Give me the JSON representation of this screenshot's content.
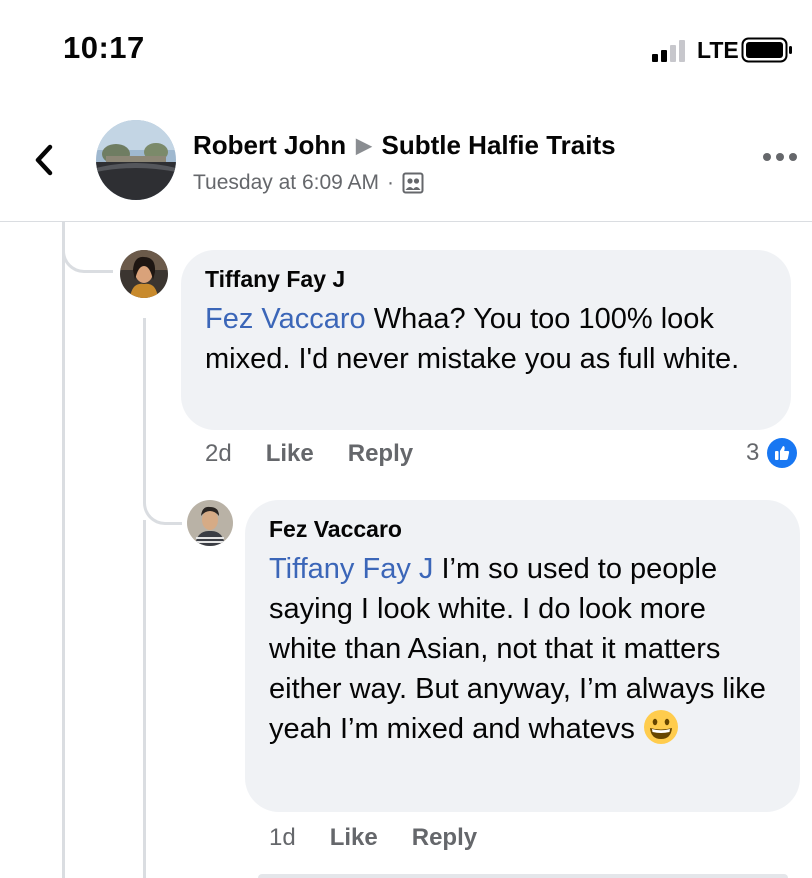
{
  "status_bar": {
    "time": "10:17",
    "network": "LTE"
  },
  "header": {
    "author": "Robert John",
    "group": "Subtle Halfie Traits",
    "timestamp": "Tuesday at 6:09 AM",
    "separator": "·"
  },
  "comments": [
    {
      "author": "Tiffany Fay J",
      "mention": "Fez Vaccaro",
      "text": " Whaa? You too 100% look mixed. I'd never mistake you as full white.",
      "age": "2d",
      "like_label": "Like",
      "reply_label": "Reply",
      "reaction_count": "3"
    },
    {
      "author": "Fez Vaccaro",
      "mention": "Tiffany Fay J",
      "text": " I’m so used to people saying I look white. I do look more white than Asian, not that it matters either way. But anyway, I’m always like yeah I’m mixed and whatevs",
      "emoji": "grinning-face",
      "age": "1d",
      "like_label": "Like",
      "reply_label": "Reply"
    }
  ]
}
